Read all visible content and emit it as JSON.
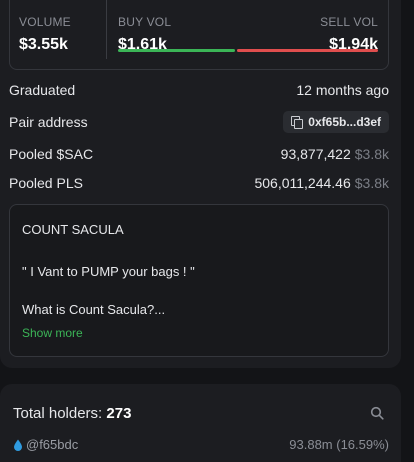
{
  "stats": {
    "volume_label": "VOLUME",
    "volume_value": "$3.55k",
    "buy_label": "BUY VOL",
    "buy_value": "$1.61k",
    "sell_label": "SELL VOL",
    "sell_value": "$1.94k",
    "buy_fraction": 0.454,
    "colors": {
      "buy": "#3bb557",
      "sell": "#e04e4e"
    }
  },
  "info": {
    "graduated_label": "Graduated",
    "graduated_value": "12 months ago",
    "pair_label": "Pair address",
    "pair_value": "0xf65b...d3ef",
    "pooled_sac_label": "Pooled $SAC",
    "pooled_sac_value": "93,877,422",
    "pooled_sac_usd": "$3.8k",
    "pooled_pls_label": "Pooled PLS",
    "pooled_pls_value": "506,011,244.46",
    "pooled_pls_usd": "$3.8k"
  },
  "description": {
    "title": "COUNT SACULA",
    "quote": "\" I Vant to PUMP your bags ! \"",
    "teaser": "What is Count Sacula?...",
    "show_more": "Show more"
  },
  "holders": {
    "label": "Total holders:",
    "count": "273",
    "top_holder": {
      "address": "@f65bdc",
      "amount": "93.88m (16.59%)",
      "icon": "water-drop-icon"
    }
  },
  "icons": {
    "copy": "copy-icon",
    "search": "search-icon"
  }
}
